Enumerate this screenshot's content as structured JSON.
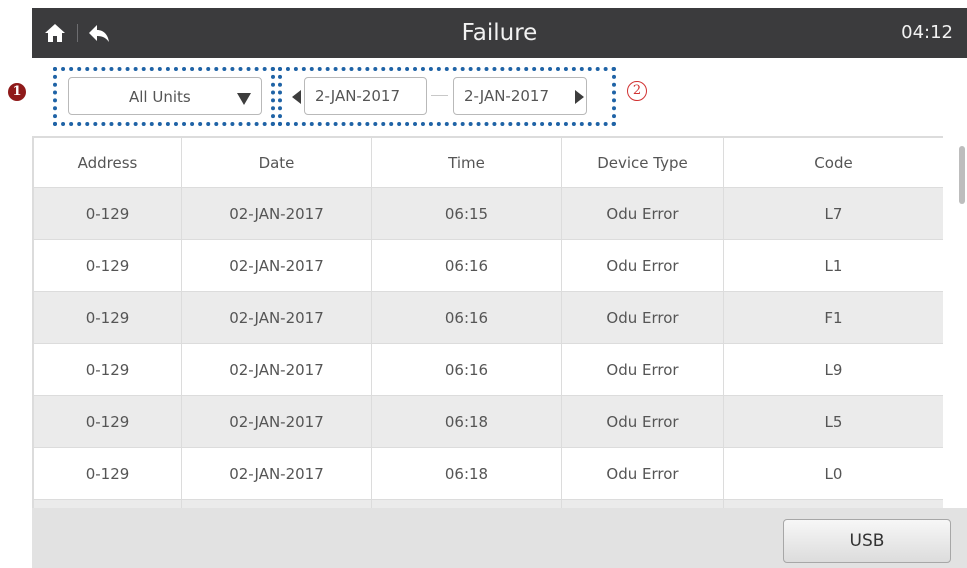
{
  "header": {
    "title": "Failure",
    "clock": "04:12",
    "home_icon": "home-icon",
    "back_icon": "back-arrow-icon",
    "bar_color": "#3b3b3d"
  },
  "callouts": {
    "marker_1": "1",
    "marker_2": "2",
    "outline_color": "#1f63a6"
  },
  "filter": {
    "unit_select": "All Units",
    "date_start": "2-JAN-2017",
    "date_end": "2-JAN-2017"
  },
  "table": {
    "columns": [
      "Address",
      "Date",
      "Time",
      "Device Type",
      "Code"
    ],
    "rows": [
      [
        "0-129",
        "02-JAN-2017",
        "06:15",
        "Odu Error",
        "L7"
      ],
      [
        "0-129",
        "02-JAN-2017",
        "06:16",
        "Odu Error",
        "L1"
      ],
      [
        "0-129",
        "02-JAN-2017",
        "06:16",
        "Odu Error",
        "F1"
      ],
      [
        "0-129",
        "02-JAN-2017",
        "06:16",
        "Odu Error",
        "L9"
      ],
      [
        "0-129",
        "02-JAN-2017",
        "06:18",
        "Odu Error",
        "L5"
      ],
      [
        "0-129",
        "02-JAN-2017",
        "06:18",
        "Odu Error",
        "L0"
      ],
      [
        "",
        "",
        "",
        "",
        ""
      ]
    ]
  },
  "footer": {
    "usb_label": "USB"
  }
}
